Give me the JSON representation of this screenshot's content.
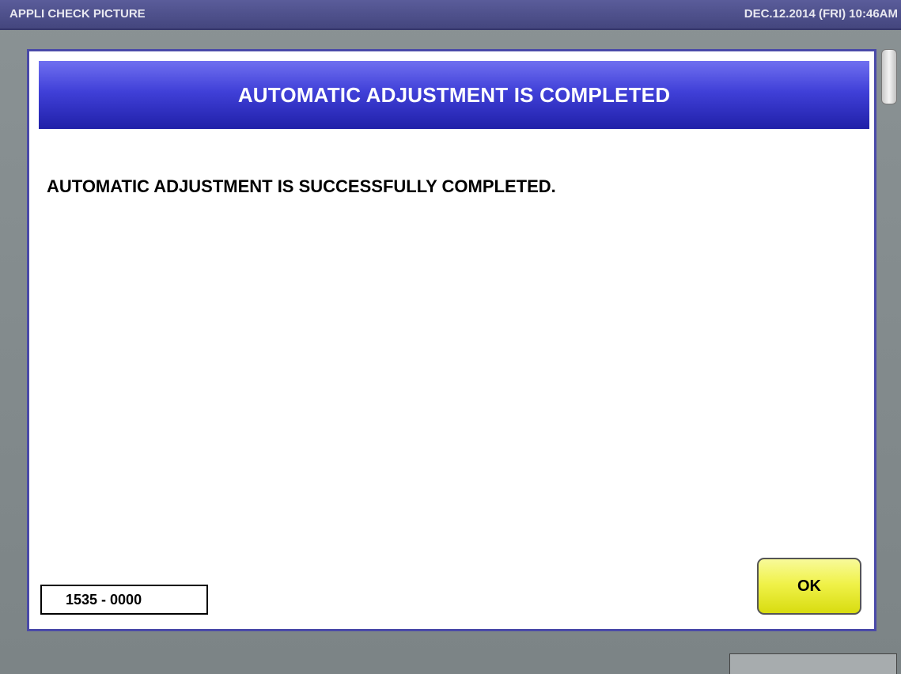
{
  "topbar": {
    "title": "APPLI CHECK PICTURE",
    "datetime": "DEC.12.2014 (FRI)  10:46AM"
  },
  "dialog": {
    "title": "AUTOMATIC ADJUSTMENT IS COMPLETED",
    "message": "AUTOMATIC ADJUSTMENT IS SUCCESSFULLY COMPLETED.",
    "code": "1535 - 0000",
    "ok_label": "OK"
  },
  "colors": {
    "topbar": "#4e5090",
    "dialog_header": "#3a3ad0",
    "dialog_border": "#4a4aa8",
    "ok_button": "#eef040"
  }
}
